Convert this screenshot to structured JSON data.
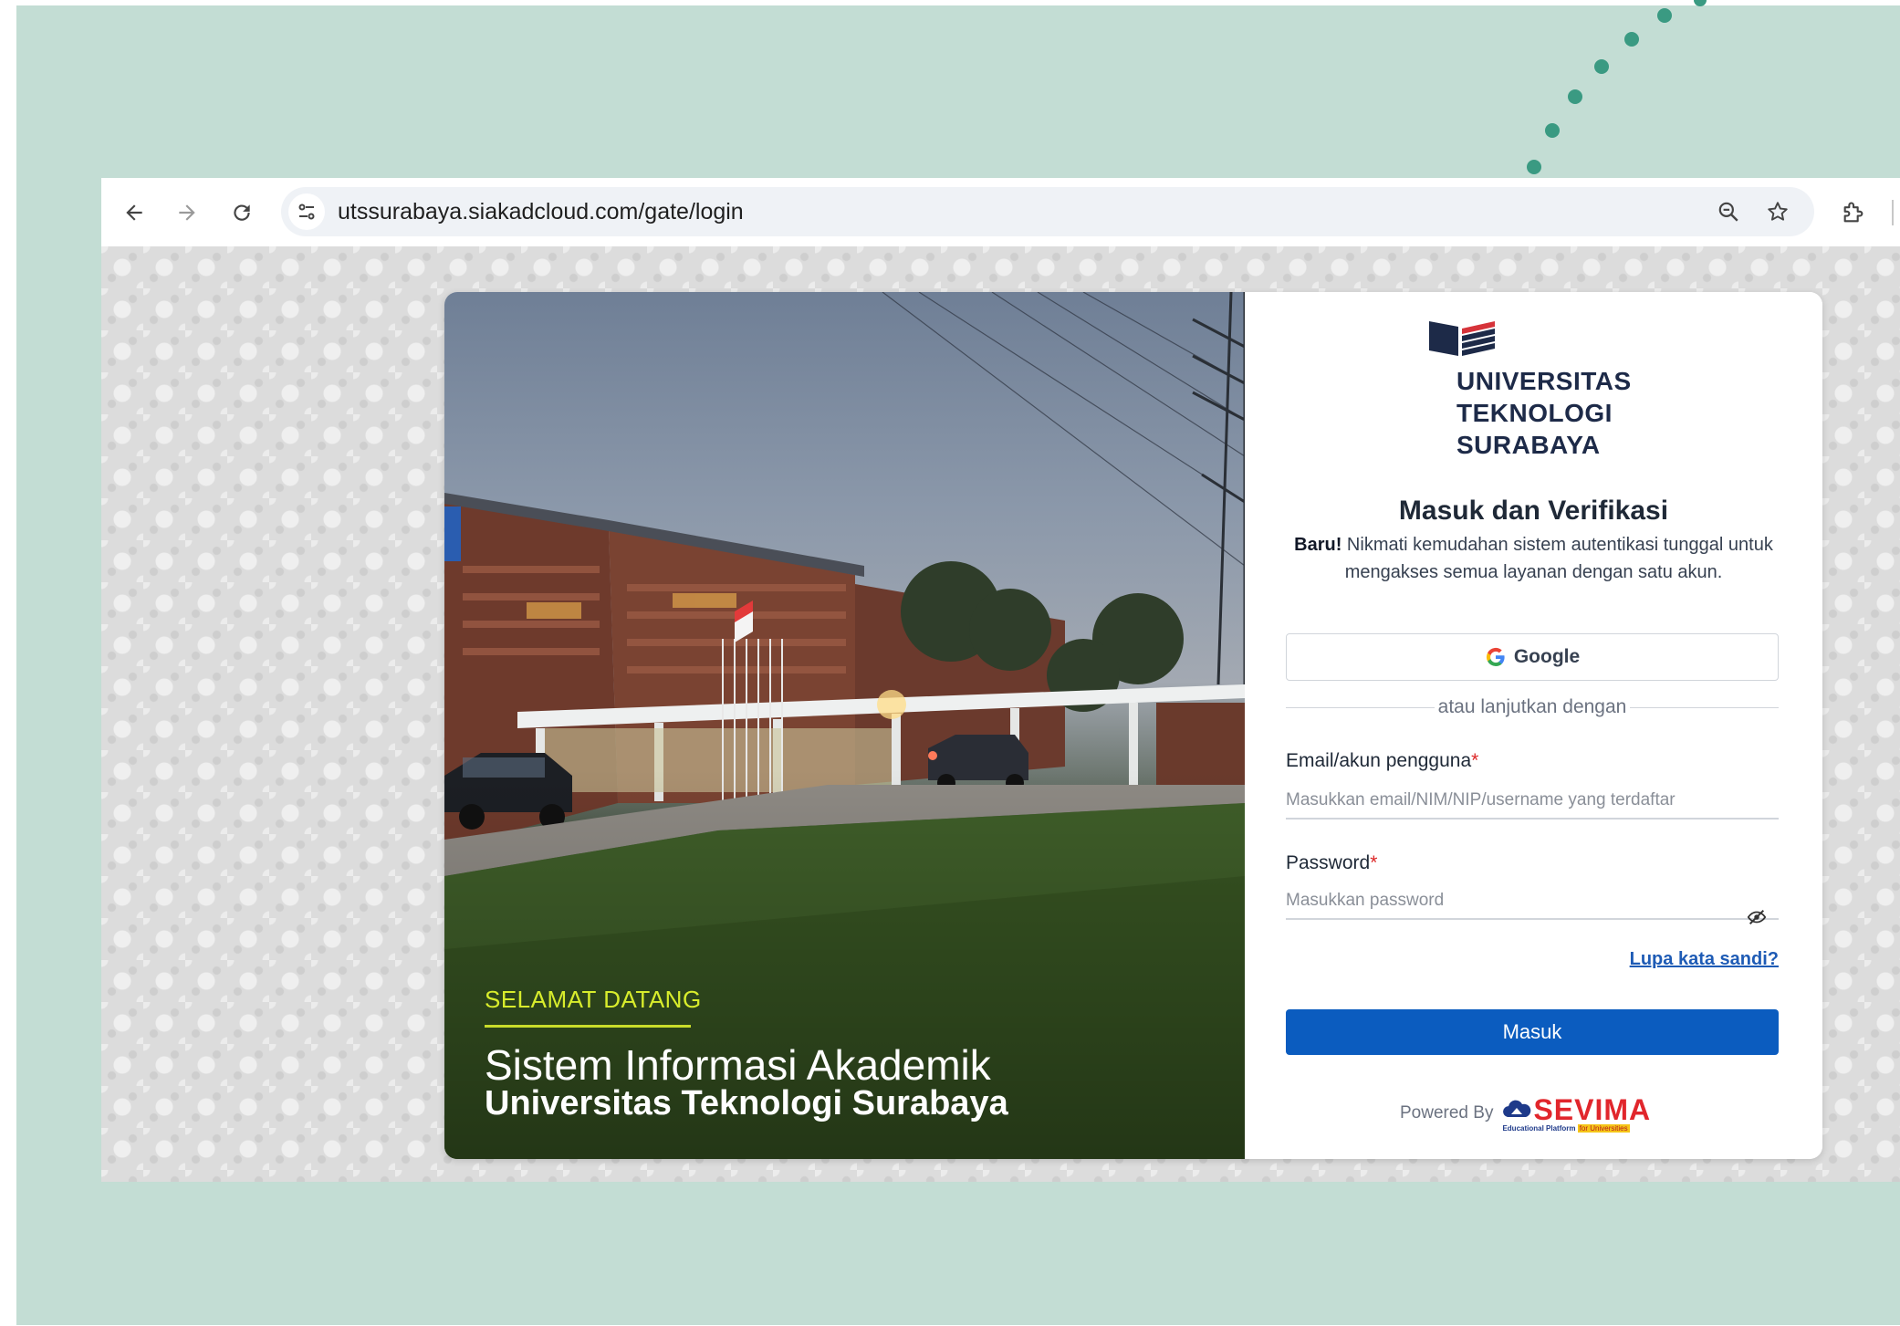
{
  "browser": {
    "url": "utssurabaya.siakadcloud.com/gate/login"
  },
  "hero": {
    "welcome": "SELAMAT DATANG",
    "system_title": "Sistem Informasi Akademik",
    "university_title": "Universitas Teknologi Surabaya"
  },
  "logo": {
    "line1": "UNIVERSITAS",
    "line2": "TEKNOLOGI",
    "line3": "SURABAYA"
  },
  "form": {
    "heading": "Masuk dan Verifikasi",
    "desc_bold": "Baru!",
    "desc_rest": " Nikmati kemudahan sistem autentikasi tunggal untuk mengakses semua layanan dengan satu akun.",
    "google_label": "Google",
    "divider_text": "atau lanjutkan dengan",
    "email_label": "Email/akun pengguna",
    "email_placeholder": "Masukkan email/NIM/NIP/username yang terdaftar",
    "password_label": "Password",
    "password_placeholder": "Masukkan password",
    "required_mark": "*",
    "forgot_label": "Lupa kata sandi?",
    "submit_label": "Masuk",
    "powered_by": "Powered By",
    "vendor_name": "SEVIMA",
    "vendor_tagline": "Educational Platform",
    "vendor_tagline_highlight": "for Universities"
  },
  "colors": {
    "slide_bg": "#c3ddd4",
    "primary": "#0b5cbf",
    "welcome": "#d8ec2c",
    "dots": "#3a9a82"
  }
}
